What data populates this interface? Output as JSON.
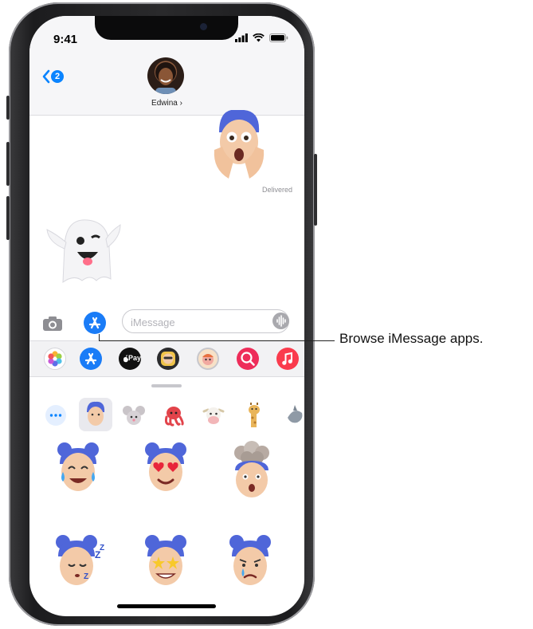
{
  "status": {
    "time": "9:41"
  },
  "header": {
    "back_badge": "2",
    "contact_name": "Edwina ›"
  },
  "conversation": {
    "delivered_label": "Delivered"
  },
  "composer": {
    "placeholder": "iMessage"
  },
  "app_drawer": {
    "apps": [
      {
        "name": "photos",
        "color": "#ffffff"
      },
      {
        "name": "app-store",
        "color": "#1a7cf7"
      },
      {
        "name": "apple-pay",
        "color": "#111111",
        "label": "Pay"
      },
      {
        "name": "memoji-stickers",
        "color": "#2b2b2d"
      },
      {
        "name": "animoji",
        "color": "#f1c38b"
      },
      {
        "name": "images-search",
        "color": "#ee2d5a"
      },
      {
        "name": "music",
        "color": "#fa3b4d"
      }
    ]
  },
  "callout": {
    "text": "Browse iMessage apps."
  },
  "colors": {
    "accent": "#0a84ff",
    "hair": "#4f66d9",
    "skin": "#f3caa8"
  }
}
